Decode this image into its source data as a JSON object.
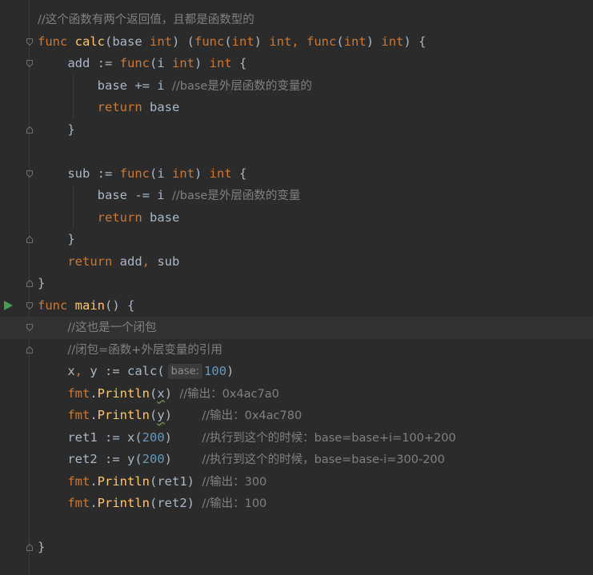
{
  "editor": {
    "language": "go",
    "run_icon_color": "#499c54",
    "lines": [
      {
        "tokens": [
          {
            "t": "//这个函数有两个返回值，且都是函数型的",
            "c": "cm"
          }
        ],
        "fold": "none"
      },
      {
        "tokens": [
          {
            "t": "func ",
            "c": "kw"
          },
          {
            "t": "calc",
            "c": "fn"
          },
          {
            "t": "(base ",
            "c": "pl"
          },
          {
            "t": "int",
            "c": "kw"
          },
          {
            "t": ") (",
            "c": "pl"
          },
          {
            "t": "func",
            "c": "kw"
          },
          {
            "t": "(",
            "c": "pl"
          },
          {
            "t": "int",
            "c": "kw"
          },
          {
            "t": ") ",
            "c": "pl"
          },
          {
            "t": "int",
            "c": "kw"
          },
          {
            "t": ", ",
            "c": "kw"
          },
          {
            "t": "func",
            "c": "kw"
          },
          {
            "t": "(",
            "c": "pl"
          },
          {
            "t": "int",
            "c": "kw"
          },
          {
            "t": ") ",
            "c": "pl"
          },
          {
            "t": "int",
            "c": "kw"
          },
          {
            "t": ") {",
            "c": "pl"
          }
        ],
        "fold": "open"
      },
      {
        "tokens": [
          {
            "t": "    add := ",
            "c": "pl"
          },
          {
            "t": "func",
            "c": "kw"
          },
          {
            "t": "(i ",
            "c": "pl"
          },
          {
            "t": "int",
            "c": "kw"
          },
          {
            "t": ") ",
            "c": "pl"
          },
          {
            "t": "int",
            "c": "kw"
          },
          {
            "t": " {",
            "c": "pl"
          }
        ],
        "fold": "open"
      },
      {
        "tokens": [
          {
            "t": "        base += i ",
            "c": "pl"
          },
          {
            "t": "//base是外层函数的变量的",
            "c": "cm"
          }
        ],
        "fold": "none"
      },
      {
        "tokens": [
          {
            "t": "        ",
            "c": "pl"
          },
          {
            "t": "return",
            "c": "kw"
          },
          {
            "t": " base",
            "c": "pl"
          }
        ],
        "fold": "none"
      },
      {
        "tokens": [
          {
            "t": "    }",
            "c": "pl"
          }
        ],
        "fold": "close"
      },
      {
        "tokens": [],
        "fold": "none"
      },
      {
        "tokens": [
          {
            "t": "    sub := ",
            "c": "pl"
          },
          {
            "t": "func",
            "c": "kw"
          },
          {
            "t": "(i ",
            "c": "pl"
          },
          {
            "t": "int",
            "c": "kw"
          },
          {
            "t": ") ",
            "c": "pl"
          },
          {
            "t": "int",
            "c": "kw"
          },
          {
            "t": " {",
            "c": "pl"
          }
        ],
        "fold": "open"
      },
      {
        "tokens": [
          {
            "t": "        base -= i ",
            "c": "pl"
          },
          {
            "t": "//base是外层函数的变量",
            "c": "cm"
          }
        ],
        "fold": "none"
      },
      {
        "tokens": [
          {
            "t": "        ",
            "c": "pl"
          },
          {
            "t": "return",
            "c": "kw"
          },
          {
            "t": " base",
            "c": "pl"
          }
        ],
        "fold": "none"
      },
      {
        "tokens": [
          {
            "t": "    }",
            "c": "pl"
          }
        ],
        "fold": "close"
      },
      {
        "tokens": [
          {
            "t": "    ",
            "c": "pl"
          },
          {
            "t": "return",
            "c": "kw"
          },
          {
            "t": " add",
            "c": "pl"
          },
          {
            "t": ",",
            "c": "kw"
          },
          {
            "t": " sub",
            "c": "pl"
          }
        ],
        "fold": "none"
      },
      {
        "tokens": [
          {
            "t": "}",
            "c": "pl"
          }
        ],
        "fold": "close"
      },
      {
        "tokens": [
          {
            "t": "func ",
            "c": "kw"
          },
          {
            "t": "main",
            "c": "fn"
          },
          {
            "t": "() {",
            "c": "pl"
          }
        ],
        "fold": "open",
        "run": true
      },
      {
        "tokens": [
          {
            "t": "    ",
            "c": "pl"
          },
          {
            "t": "//这也是一个闭包",
            "c": "cm"
          }
        ],
        "fold": "open",
        "highlight": true
      },
      {
        "tokens": [
          {
            "t": "    ",
            "c": "pl"
          },
          {
            "t": "//闭包=函数+外层变量的引用",
            "c": "cm"
          }
        ],
        "fold": "close"
      },
      {
        "tokens": [
          {
            "t": "    x",
            "c": "pl"
          },
          {
            "t": ",",
            "c": "kw"
          },
          {
            "t": " y := calc(",
            "c": "pl"
          },
          {
            "t": "base:",
            "c": "hint"
          },
          {
            "t": "100",
            "c": "num"
          },
          {
            "t": ")",
            "c": "pl"
          }
        ],
        "fold": "none"
      },
      {
        "tokens": [
          {
            "t": "    ",
            "c": "pl"
          },
          {
            "t": "fmt",
            "c": "kw"
          },
          {
            "t": ".",
            "c": "pl"
          },
          {
            "t": "Println",
            "c": "fn"
          },
          {
            "t": "(",
            "c": "pl"
          },
          {
            "t": "x",
            "c": "sq"
          },
          {
            "t": ") ",
            "c": "pl"
          },
          {
            "t": "//输出：0x4ac7a0",
            "c": "cm"
          }
        ],
        "fold": "none"
      },
      {
        "tokens": [
          {
            "t": "    ",
            "c": "pl"
          },
          {
            "t": "fmt",
            "c": "kw"
          },
          {
            "t": ".",
            "c": "pl"
          },
          {
            "t": "Println",
            "c": "fn"
          },
          {
            "t": "(",
            "c": "pl"
          },
          {
            "t": "y",
            "c": "sq"
          },
          {
            "t": ")    ",
            "c": "pl"
          },
          {
            "t": "//输出：0x4ac780",
            "c": "cm"
          }
        ],
        "fold": "none"
      },
      {
        "tokens": [
          {
            "t": "    ret1 := x(",
            "c": "pl"
          },
          {
            "t": "200",
            "c": "num"
          },
          {
            "t": ")    ",
            "c": "pl"
          },
          {
            "t": "//执行到这个的时候：base=base+i=100+200",
            "c": "cm"
          }
        ],
        "fold": "none"
      },
      {
        "tokens": [
          {
            "t": "    ret2 := y(",
            "c": "pl"
          },
          {
            "t": "200",
            "c": "num"
          },
          {
            "t": ")    ",
            "c": "pl"
          },
          {
            "t": "//执行到这个的时候，base=base-i=300-200",
            "c": "cm"
          }
        ],
        "fold": "none"
      },
      {
        "tokens": [
          {
            "t": "    ",
            "c": "pl"
          },
          {
            "t": "fmt",
            "c": "kw"
          },
          {
            "t": ".",
            "c": "pl"
          },
          {
            "t": "Println",
            "c": "fn"
          },
          {
            "t": "(ret1) ",
            "c": "pl"
          },
          {
            "t": "//输出：300",
            "c": "cm"
          }
        ],
        "fold": "none"
      },
      {
        "tokens": [
          {
            "t": "    ",
            "c": "pl"
          },
          {
            "t": "fmt",
            "c": "kw"
          },
          {
            "t": ".",
            "c": "pl"
          },
          {
            "t": "Println",
            "c": "fn"
          },
          {
            "t": "(ret2) ",
            "c": "pl"
          },
          {
            "t": "//输出：100",
            "c": "cm"
          }
        ],
        "fold": "none"
      },
      {
        "tokens": [],
        "fold": "none"
      },
      {
        "tokens": [
          {
            "t": "}",
            "c": "pl"
          }
        ],
        "fold": "close"
      }
    ]
  }
}
